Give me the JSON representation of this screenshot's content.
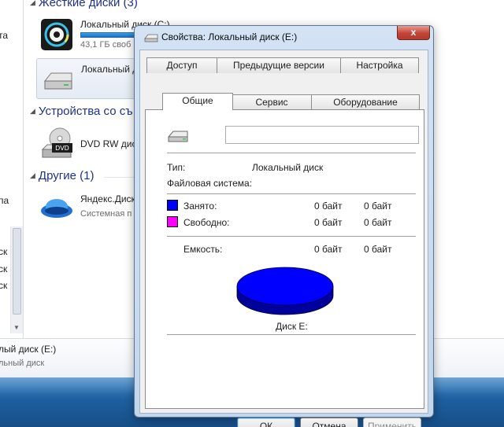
{
  "explorer": {
    "nav_fragments": [
      "та",
      "па",
      "ск",
      "ск",
      "ск"
    ],
    "sections": {
      "hard_disks": "Жесткие диски (3)",
      "removable": "Устройства со съ",
      "other": "Другие (1)"
    },
    "drives": {
      "c": {
        "name": "Локальный диск (C:)",
        "free": "43,1 ГБ своб"
      },
      "e": {
        "name": "Локальный д"
      },
      "dvd": {
        "name": "DVD RW диск",
        "badge": "DVD"
      },
      "yandex": {
        "name": "Яндекс.Диск",
        "sub": "Системная п"
      }
    },
    "details": {
      "title": "лый диск (E:)",
      "sub": "льный диск"
    }
  },
  "dialog": {
    "title": "Свойства: Локальный диск (E:)",
    "close_label": "x",
    "tabs_row1": [
      "Доступ",
      "Предыдущие версии",
      "Настройка"
    ],
    "tabs_row2": [
      "Общие",
      "Сервис",
      "Оборудование"
    ],
    "general": {
      "volume_label_value": "",
      "type_label": "Тип:",
      "type_value": "Локальный диск",
      "fs_label": "Файловая система:",
      "used_label": "Занято:",
      "used_bytes": "0 байт",
      "used_size": "0 байт",
      "free_label": "Свободно:",
      "free_bytes": "0 байт",
      "free_size": "0 байт",
      "capacity_label": "Емкость:",
      "capacity_bytes": "0 байт",
      "capacity_size": "0 байт",
      "disk_caption": "Диск E:",
      "used_color": "#0000ff",
      "free_color": "#ff00ff"
    },
    "buttons": {
      "ok": "ОК",
      "cancel": "Отмена",
      "apply": "Применить"
    }
  }
}
